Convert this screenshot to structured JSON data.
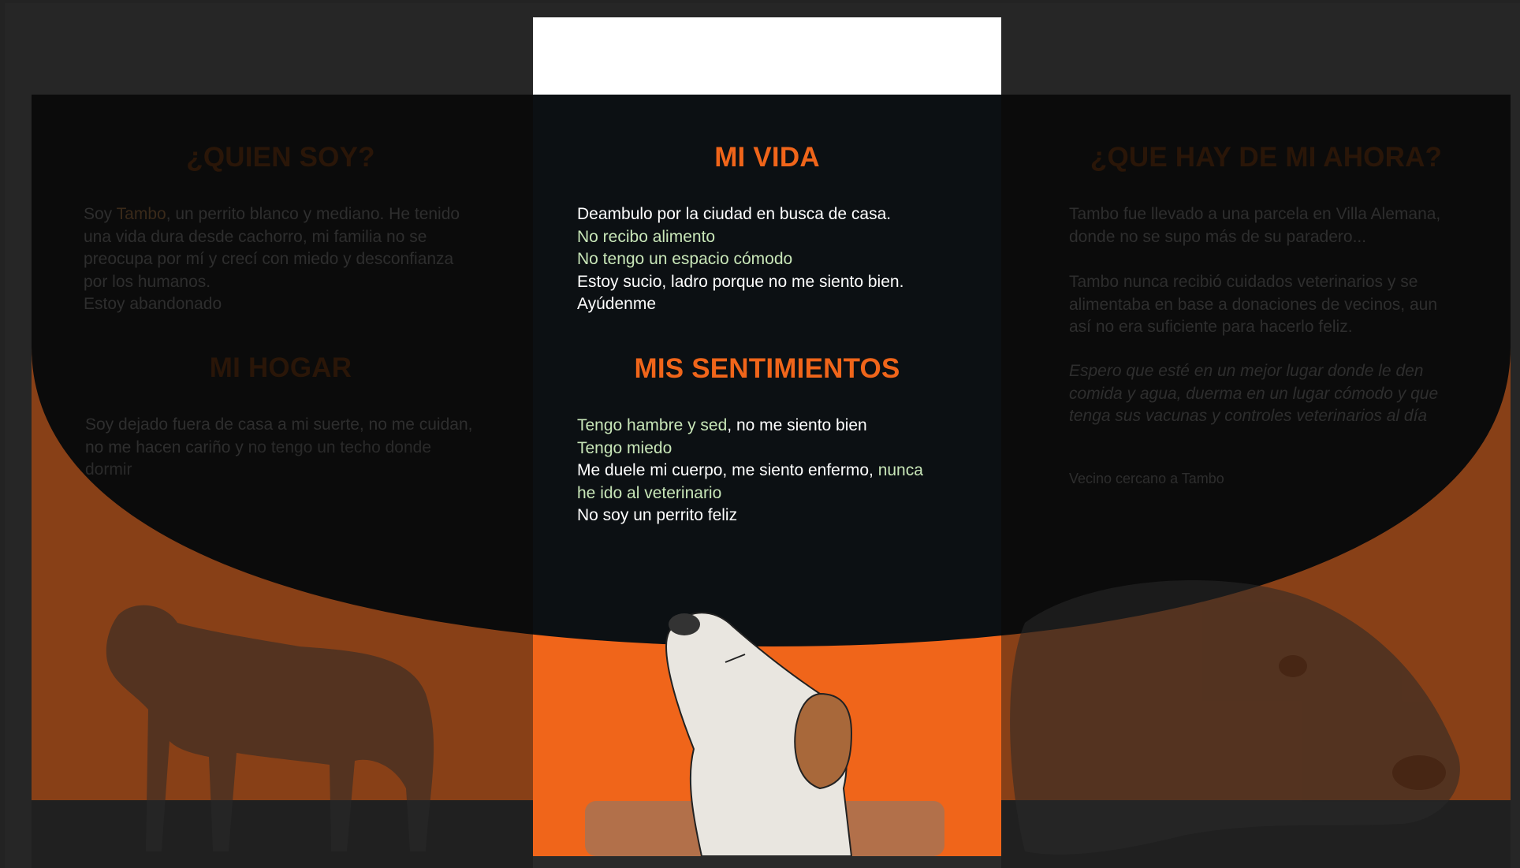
{
  "left": {
    "heading1": "¿QUIEN SOY?",
    "para1": {
      "a": "Soy ",
      "b": "Tambo",
      "c": ", un perrito blanco y mediano. He tenido una vida dura desde cachorro, mi familia no se preocupa por mí y crecí con miedo y desconfianza por los humanos.",
      "d": "Estoy abandonado"
    },
    "heading2": "MI HOGAR",
    "para2": {
      "a": "Soy dejado fuera de casa a mi suerte, no me cuidan, no me hacen cariño y ",
      "b": "no tengo un techo donde dormir"
    }
  },
  "center": {
    "heading1": "MI VIDA",
    "vida_lines": [
      "Deambulo por la ciudad en busca de casa.",
      "No recibo alimento",
      "No tengo un espacio cómodo",
      "Estoy sucio, ladro porque no me siento bien.",
      "Ayúdenme"
    ],
    "heading2": "MIS SENTIMIENTOS",
    "sent": {
      "l1a": "Tengo hambre y sed",
      "l1b": ", no me siento bien",
      "l2": "Tengo miedo",
      "l3a": "Me duele mi cuerpo, me siento enfermo, ",
      "l3b": "nunca",
      "l4": "he ido al veterinario",
      "l5": "No soy un perrito feliz"
    }
  },
  "right": {
    "heading": "¿QUE HAY DE MI AHORA?",
    "para1": "Tambo fue llevado a una parcela en Villa Alemana, donde no se supo más de su paradero...",
    "para2": "Tambo nunca recibió cuidados veterinarios y se alimentaba en base a donaciones de vecinos, aun así no era suficiente para hacerlo feliz.",
    "quote": "Espero que esté en un mejor lugar donde le den comida y agua, duerma en un lugar cómodo y que tenga sus vacunas y controles veterinarios al día",
    "signature": "Vecino cercano a Tambo"
  },
  "colors": {
    "orange": "#e8651a",
    "text_white": "#ffffff",
    "text_green": "#c8e6b8",
    "heading_orange": "#f0651a"
  }
}
